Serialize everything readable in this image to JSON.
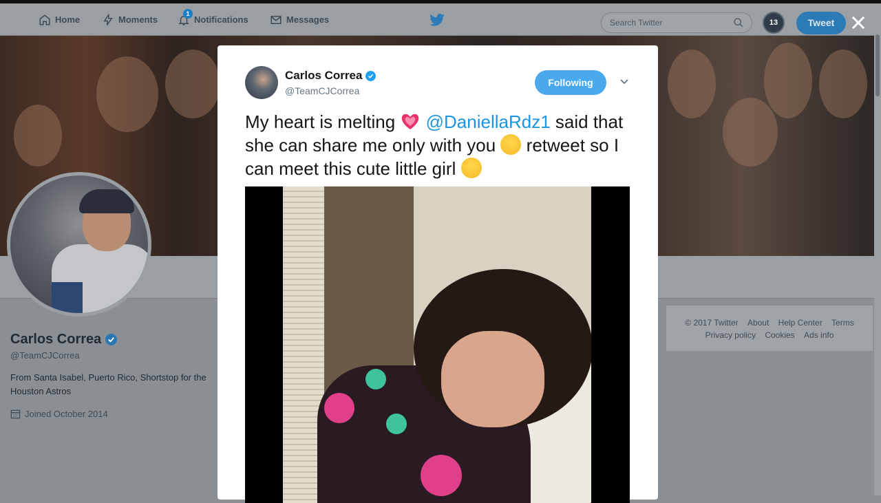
{
  "nav": {
    "home": "Home",
    "moments": "Moments",
    "notifications": "Notifications",
    "notifications_count": "1",
    "messages": "Messages",
    "search_placeholder": "Search Twitter",
    "account_badge": "13",
    "tweet_button": "Tweet"
  },
  "profile": {
    "name": "Carlos Correa",
    "handle": "@TeamCJCorrea",
    "bio": "From Santa Isabel, Puerto Rico, Shortstop for the Houston Astros",
    "joined": "Joined October 2014"
  },
  "footer": {
    "copyright": "© 2017 Twitter",
    "about": "About",
    "help": "Help Center",
    "terms": "Terms",
    "privacy": "Privacy policy",
    "cookies": "Cookies",
    "ads": "Ads info"
  },
  "tweet": {
    "author_name": "Carlos Correa",
    "author_handle": "@TeamCJCorrea",
    "follow_state": "Following",
    "text_part1": "My heart is melting ",
    "mention": "@DaniellaRdz1",
    "text_part2": " said that she can share me only with you ",
    "text_part3": " retweet so I can meet this cute little girl "
  },
  "colors": {
    "accent": "#1da1f2",
    "follow_button": "#4aa8ec",
    "mention": "#1b95e0"
  },
  "icons": [
    "home-icon",
    "moments-icon",
    "notifications-icon",
    "messages-icon",
    "twitter-bird-icon",
    "search-icon",
    "close-icon",
    "chevron-down-icon",
    "verified-icon",
    "calendar-icon"
  ]
}
